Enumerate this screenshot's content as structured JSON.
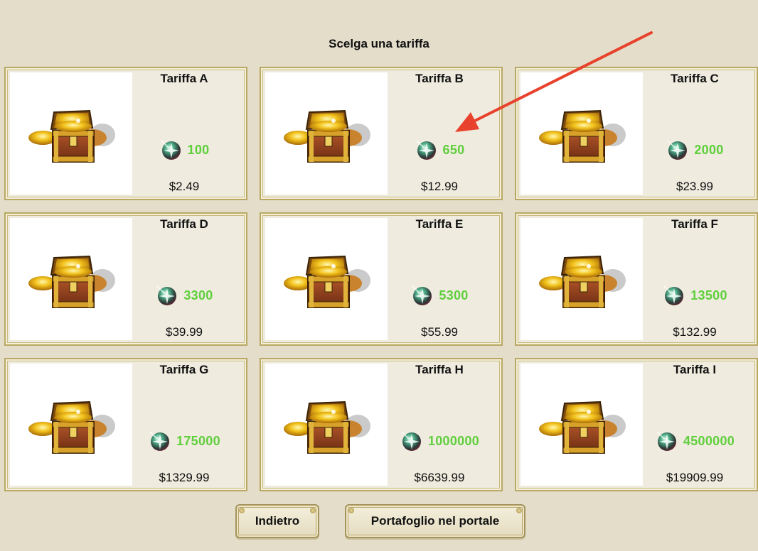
{
  "heading": "Scelga una tariffa",
  "colors": {
    "amount": "#5fcf3c",
    "annotation_arrow": "#e8412c"
  },
  "plans": [
    {
      "title": "Tariffa A",
      "amount": "100",
      "price": "$2.49",
      "icon": "treasure-chest-icon"
    },
    {
      "title": "Tariffa B",
      "amount": "650",
      "price": "$12.99",
      "icon": "treasure-chest-icon"
    },
    {
      "title": "Tariffa C",
      "amount": "2000",
      "price": "$23.99",
      "icon": "treasure-chest-icon"
    },
    {
      "title": "Tariffa D",
      "amount": "3300",
      "price": "$39.99",
      "icon": "treasure-chest-icon"
    },
    {
      "title": "Tariffa E",
      "amount": "5300",
      "price": "$55.99",
      "icon": "treasure-chest-icon"
    },
    {
      "title": "Tariffa F",
      "amount": "13500",
      "price": "$132.99",
      "icon": "treasure-chest-icon"
    },
    {
      "title": "Tariffa G",
      "amount": "175000",
      "price": "$1329.99",
      "icon": "treasure-chest-icon"
    },
    {
      "title": "Tariffa H",
      "amount": "1000000",
      "price": "$6639.99",
      "icon": "treasure-chest-icon"
    },
    {
      "title": "Tariffa I",
      "amount": "4500000",
      "price": "$19909.99",
      "icon": "treasure-chest-icon"
    }
  ],
  "currency_icon": "gem-icon",
  "buttons": {
    "back": "Indietro",
    "wallet": "Portafoglio nel portale"
  }
}
